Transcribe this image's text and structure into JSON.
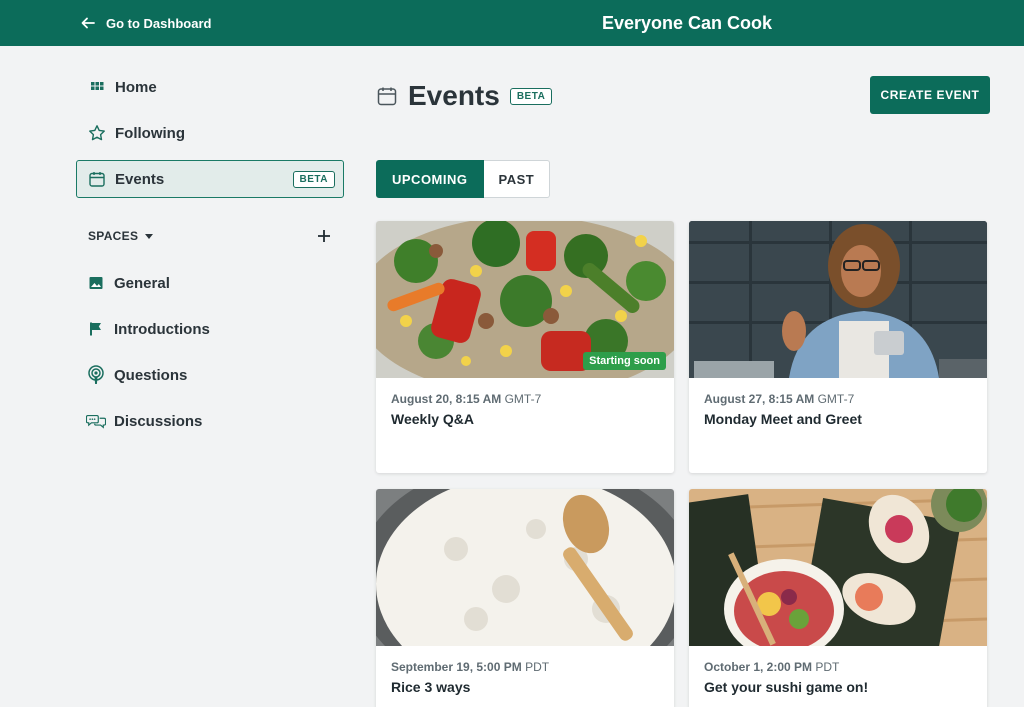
{
  "header": {
    "back_label": "Go to Dashboard",
    "app_title": "Everyone Can Cook"
  },
  "sidebar": {
    "items": [
      {
        "label": "Home",
        "icon": "grid-icon"
      },
      {
        "label": "Following",
        "icon": "star-icon"
      },
      {
        "label": "Events",
        "icon": "calendar-icon",
        "badge": "BETA",
        "active": true
      }
    ],
    "spaces_label": "SPACES",
    "spaces": [
      {
        "label": "General",
        "icon": "image-icon"
      },
      {
        "label": "Introductions",
        "icon": "flag-icon"
      },
      {
        "label": "Questions",
        "icon": "podcast-icon"
      },
      {
        "label": "Discussions",
        "icon": "chat-bubbles-icon"
      }
    ]
  },
  "main": {
    "title": "Events",
    "title_badge": "BETA",
    "create_button": "CREATE EVENT",
    "tabs": [
      {
        "label": "UPCOMING",
        "active": true
      },
      {
        "label": "PAST",
        "active": false
      }
    ],
    "events": [
      {
        "date": "August 20, 8:15 AM",
        "tz": "GMT-7",
        "title": "Weekly Q&A",
        "badge": "Starting soon",
        "image": "stir-fry-vegetables"
      },
      {
        "date": "August 27, 8:15 AM",
        "tz": "GMT-7",
        "title": "Monday Meet and Greet",
        "image": "woman-waving-at-laptop"
      },
      {
        "date": "September 19, 5:00 PM",
        "tz": "PDT",
        "title": "Rice 3 ways",
        "image": "bowl-of-rice"
      },
      {
        "date": "October 1, 2:00 PM",
        "tz": "PDT",
        "title": "Get your sushi game on!",
        "image": "sushi-rolls"
      }
    ]
  },
  "colors": {
    "brand": "#0c6c5a",
    "background": "#f2f3f4",
    "badge_green": "#2e9e4a"
  }
}
